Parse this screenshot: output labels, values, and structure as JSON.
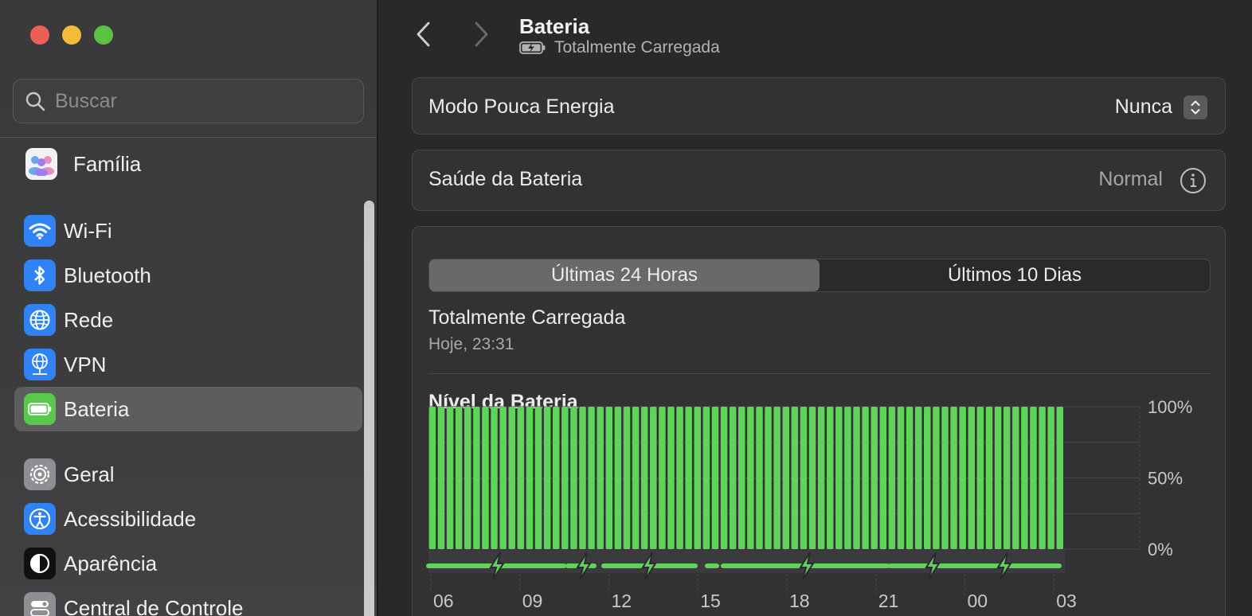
{
  "window": {
    "controls": [
      "close",
      "minimize",
      "zoom"
    ]
  },
  "sidebar": {
    "search_placeholder": "Buscar",
    "items": [
      {
        "label": "Família",
        "icon": "family-icon",
        "selected": false
      },
      {
        "label": "Wi-Fi",
        "icon": "wifi-icon",
        "selected": false
      },
      {
        "label": "Bluetooth",
        "icon": "bluetooth-icon",
        "selected": false
      },
      {
        "label": "Rede",
        "icon": "globe-icon",
        "selected": false
      },
      {
        "label": "VPN",
        "icon": "vpn-globe-icon",
        "selected": false
      },
      {
        "label": "Bateria",
        "icon": "battery-icon",
        "selected": true
      },
      {
        "label": "Geral",
        "icon": "gear-icon",
        "selected": false
      },
      {
        "label": "Acessibilidade",
        "icon": "accessibility-icon",
        "selected": false
      },
      {
        "label": "Aparência",
        "icon": "appearance-icon",
        "selected": false
      },
      {
        "label": "Central de Controle",
        "icon": "control-center-icon",
        "selected": false
      }
    ]
  },
  "header": {
    "title": "Bateria",
    "subtitle": "Totalmente Carregada"
  },
  "low_power": {
    "label": "Modo Pouca Energia",
    "value": "Nunca"
  },
  "health": {
    "label": "Saúde da Bateria",
    "value": "Normal"
  },
  "usage": {
    "tabs": [
      {
        "label": "Últimas 24 Horas",
        "active": true
      },
      {
        "label": "Últimos 10 Dias",
        "active": false
      }
    ],
    "status_title": "Totalmente Carregada",
    "status_time": "Hoje, 23:31",
    "chart_title": "Nível da Bateria"
  },
  "chart_data": {
    "type": "bar",
    "title": "Nível da Bateria",
    "x_tick_labels": [
      "06",
      "09",
      "12",
      "15",
      "18",
      "21",
      "00",
      "03"
    ],
    "y_tick_labels": [
      "100%",
      "50%",
      "0%"
    ],
    "ylim": [
      0,
      100
    ],
    "bar_count": 72,
    "values": [
      100,
      100,
      100,
      100,
      100,
      100,
      100,
      100,
      100,
      100,
      100,
      100,
      100,
      100,
      100,
      100,
      100,
      100,
      100,
      100,
      100,
      100,
      100,
      100,
      100,
      100,
      100,
      100,
      100,
      100,
      100,
      100,
      100,
      100,
      100,
      100,
      100,
      100,
      100,
      100,
      100,
      100,
      100,
      100,
      100,
      100,
      100,
      100,
      100,
      100,
      100,
      100,
      100,
      100,
      100,
      100,
      100,
      100,
      100,
      100,
      100,
      100,
      100,
      100,
      100,
      100,
      100,
      100,
      100,
      100,
      100,
      100
    ],
    "bar_color": "#5fd35a",
    "charging_markers_near_ticks": [
      "06",
      "09",
      "12",
      "18",
      "21",
      "00"
    ],
    "grid": true
  }
}
